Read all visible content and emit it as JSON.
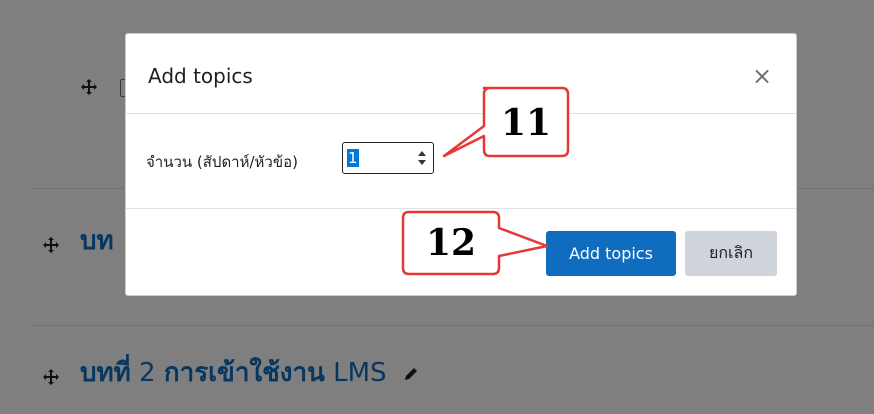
{
  "background": {
    "sections": [
      {
        "prefix": "บท",
        "title": ""
      },
      {
        "prefix": "บทที่",
        "number": "2",
        "title": "การเข้าใช้งาน",
        "suffix": "LMS"
      }
    ]
  },
  "modal": {
    "title": "Add topics",
    "close_label": "×",
    "field_label": "จำนวน (สัปดาห์/หัวข้อ)",
    "field_value": "1",
    "submit_label": "Add topics",
    "cancel_label": "ยกเลิก"
  },
  "annotations": {
    "callout_11": "11",
    "callout_12": "12"
  },
  "colors": {
    "accent": "#0f6cbf",
    "callout_border": "#e53935",
    "backdrop": "rgba(0,0,0,0.5)"
  },
  "icons": {
    "move": "move-icon",
    "edit": "pencil-icon",
    "close": "close-icon",
    "spinner": "spinner-arrows-icon"
  }
}
